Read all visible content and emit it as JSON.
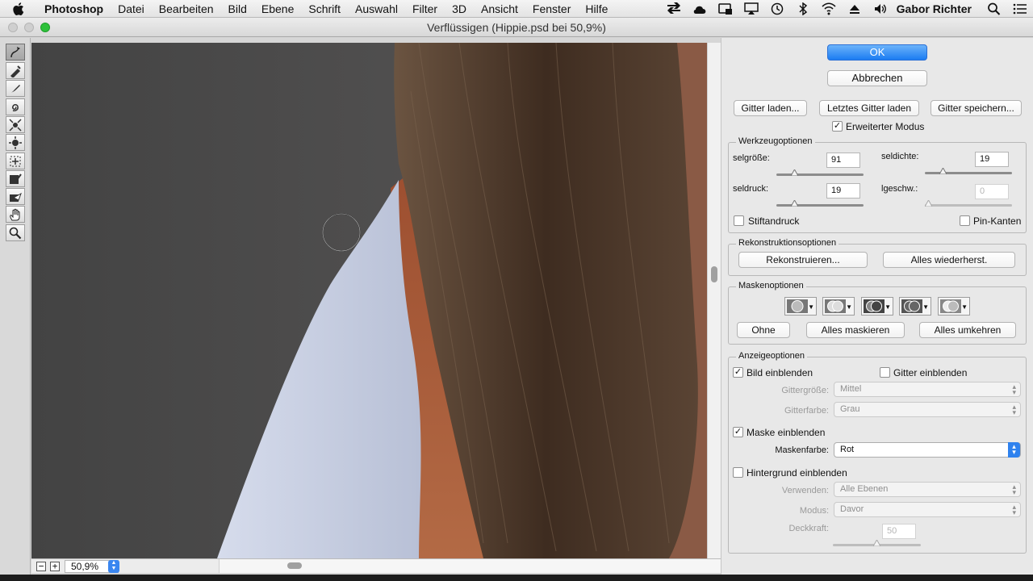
{
  "menubar": {
    "app_name": "Photoshop",
    "menus": [
      "Datei",
      "Bearbeiten",
      "Bild",
      "Ebene",
      "Schrift",
      "Auswahl",
      "Filter",
      "3D",
      "Ansicht",
      "Fenster",
      "Hilfe"
    ],
    "user_name": "Gabor Richter"
  },
  "window": {
    "title": "Verflüssigen (Hippie.psd bei 50,9%)"
  },
  "canvas": {
    "zoom_value": "50,9%"
  },
  "panel": {
    "ok_label": "OK",
    "cancel_label": "Abbrechen",
    "load_mesh": "Gitter laden...",
    "load_last_mesh": "Letztes Gitter laden",
    "save_mesh": "Gitter speichern...",
    "advanced_mode": {
      "label": "Erweiterter Modus",
      "checked": true
    },
    "tool_options": {
      "title": "Werkzeugoptionen",
      "brush_size": {
        "label": "selgröße:",
        "value": "91"
      },
      "brush_density": {
        "label": "seldichte:",
        "value": "19"
      },
      "brush_pressure": {
        "label": "seldruck:",
        "value": "19"
      },
      "brush_rate": {
        "label": "lgeschw.:",
        "value": "0"
      },
      "stylus_pressure": {
        "label": "Stiftandruck",
        "checked": false
      },
      "pin_edges": {
        "label": "Pin-Kanten",
        "checked": false
      }
    },
    "reconstruct_options": {
      "title": "Rekonstruktionsoptionen",
      "reconstruct": "Rekonstruieren...",
      "restore_all": "Alles wiederherst."
    },
    "mask_options": {
      "title": "Maskenoptionen",
      "none": "Ohne",
      "mask_all": "Alles maskieren",
      "invert_all": "Alles umkehren"
    },
    "view_options": {
      "title": "Anzeigeoptionen",
      "show_image": {
        "label": "Bild einblenden",
        "checked": true
      },
      "show_mesh": {
        "label": "Gitter einblenden",
        "checked": false
      },
      "mesh_size": {
        "label": "Gittergröße:",
        "value": "Mittel"
      },
      "mesh_color": {
        "label": "Gitterfarbe:",
        "value": "Grau"
      },
      "show_mask": {
        "label": "Maske einblenden",
        "checked": true
      },
      "mask_color": {
        "label": "Maskenfarbe:",
        "value": "Rot"
      },
      "show_backdrop": {
        "label": "Hintergrund einblenden",
        "checked": false
      },
      "use": {
        "label": "Verwenden:",
        "value": "Alle Ebenen"
      },
      "mode": {
        "label": "Modus:",
        "value": "Davor"
      },
      "opacity": {
        "label": "Deckkraft:",
        "value": "50"
      }
    }
  },
  "colors": {
    "accent": "#2f82ee",
    "backdrop_gray": "#4a4a4a",
    "shirt": "#c9d1e3",
    "hair": "#4a3526",
    "skin": "#a7552f"
  }
}
